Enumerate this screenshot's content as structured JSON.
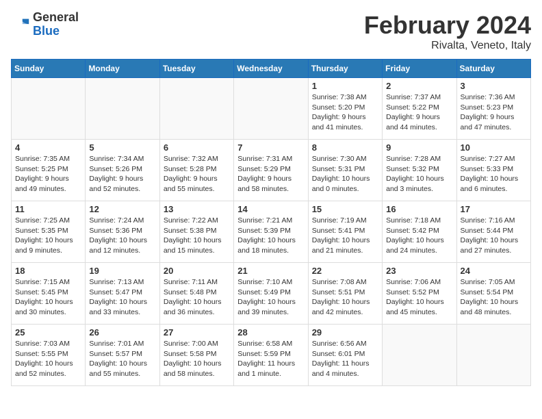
{
  "header": {
    "logo_general": "General",
    "logo_blue": "Blue",
    "month_title": "February 2024",
    "location": "Rivalta, Veneto, Italy"
  },
  "days_of_week": [
    "Sunday",
    "Monday",
    "Tuesday",
    "Wednesday",
    "Thursday",
    "Friday",
    "Saturday"
  ],
  "weeks": [
    [
      {
        "day": "",
        "info": ""
      },
      {
        "day": "",
        "info": ""
      },
      {
        "day": "",
        "info": ""
      },
      {
        "day": "",
        "info": ""
      },
      {
        "day": "1",
        "sunrise": "Sunrise: 7:38 AM",
        "sunset": "Sunset: 5:20 PM",
        "daylight": "Daylight: 9 hours and 41 minutes."
      },
      {
        "day": "2",
        "sunrise": "Sunrise: 7:37 AM",
        "sunset": "Sunset: 5:22 PM",
        "daylight": "Daylight: 9 hours and 44 minutes."
      },
      {
        "day": "3",
        "sunrise": "Sunrise: 7:36 AM",
        "sunset": "Sunset: 5:23 PM",
        "daylight": "Daylight: 9 hours and 47 minutes."
      }
    ],
    [
      {
        "day": "4",
        "sunrise": "Sunrise: 7:35 AM",
        "sunset": "Sunset: 5:25 PM",
        "daylight": "Daylight: 9 hours and 49 minutes."
      },
      {
        "day": "5",
        "sunrise": "Sunrise: 7:34 AM",
        "sunset": "Sunset: 5:26 PM",
        "daylight": "Daylight: 9 hours and 52 minutes."
      },
      {
        "day": "6",
        "sunrise": "Sunrise: 7:32 AM",
        "sunset": "Sunset: 5:28 PM",
        "daylight": "Daylight: 9 hours and 55 minutes."
      },
      {
        "day": "7",
        "sunrise": "Sunrise: 7:31 AM",
        "sunset": "Sunset: 5:29 PM",
        "daylight": "Daylight: 9 hours and 58 minutes."
      },
      {
        "day": "8",
        "sunrise": "Sunrise: 7:30 AM",
        "sunset": "Sunset: 5:31 PM",
        "daylight": "Daylight: 10 hours and 0 minutes."
      },
      {
        "day": "9",
        "sunrise": "Sunrise: 7:28 AM",
        "sunset": "Sunset: 5:32 PM",
        "daylight": "Daylight: 10 hours and 3 minutes."
      },
      {
        "day": "10",
        "sunrise": "Sunrise: 7:27 AM",
        "sunset": "Sunset: 5:33 PM",
        "daylight": "Daylight: 10 hours and 6 minutes."
      }
    ],
    [
      {
        "day": "11",
        "sunrise": "Sunrise: 7:25 AM",
        "sunset": "Sunset: 5:35 PM",
        "daylight": "Daylight: 10 hours and 9 minutes."
      },
      {
        "day": "12",
        "sunrise": "Sunrise: 7:24 AM",
        "sunset": "Sunset: 5:36 PM",
        "daylight": "Daylight: 10 hours and 12 minutes."
      },
      {
        "day": "13",
        "sunrise": "Sunrise: 7:22 AM",
        "sunset": "Sunset: 5:38 PM",
        "daylight": "Daylight: 10 hours and 15 minutes."
      },
      {
        "day": "14",
        "sunrise": "Sunrise: 7:21 AM",
        "sunset": "Sunset: 5:39 PM",
        "daylight": "Daylight: 10 hours and 18 minutes."
      },
      {
        "day": "15",
        "sunrise": "Sunrise: 7:19 AM",
        "sunset": "Sunset: 5:41 PM",
        "daylight": "Daylight: 10 hours and 21 minutes."
      },
      {
        "day": "16",
        "sunrise": "Sunrise: 7:18 AM",
        "sunset": "Sunset: 5:42 PM",
        "daylight": "Daylight: 10 hours and 24 minutes."
      },
      {
        "day": "17",
        "sunrise": "Sunrise: 7:16 AM",
        "sunset": "Sunset: 5:44 PM",
        "daylight": "Daylight: 10 hours and 27 minutes."
      }
    ],
    [
      {
        "day": "18",
        "sunrise": "Sunrise: 7:15 AM",
        "sunset": "Sunset: 5:45 PM",
        "daylight": "Daylight: 10 hours and 30 minutes."
      },
      {
        "day": "19",
        "sunrise": "Sunrise: 7:13 AM",
        "sunset": "Sunset: 5:47 PM",
        "daylight": "Daylight: 10 hours and 33 minutes."
      },
      {
        "day": "20",
        "sunrise": "Sunrise: 7:11 AM",
        "sunset": "Sunset: 5:48 PM",
        "daylight": "Daylight: 10 hours and 36 minutes."
      },
      {
        "day": "21",
        "sunrise": "Sunrise: 7:10 AM",
        "sunset": "Sunset: 5:49 PM",
        "daylight": "Daylight: 10 hours and 39 minutes."
      },
      {
        "day": "22",
        "sunrise": "Sunrise: 7:08 AM",
        "sunset": "Sunset: 5:51 PM",
        "daylight": "Daylight: 10 hours and 42 minutes."
      },
      {
        "day": "23",
        "sunrise": "Sunrise: 7:06 AM",
        "sunset": "Sunset: 5:52 PM",
        "daylight": "Daylight: 10 hours and 45 minutes."
      },
      {
        "day": "24",
        "sunrise": "Sunrise: 7:05 AM",
        "sunset": "Sunset: 5:54 PM",
        "daylight": "Daylight: 10 hours and 48 minutes."
      }
    ],
    [
      {
        "day": "25",
        "sunrise": "Sunrise: 7:03 AM",
        "sunset": "Sunset: 5:55 PM",
        "daylight": "Daylight: 10 hours and 52 minutes."
      },
      {
        "day": "26",
        "sunrise": "Sunrise: 7:01 AM",
        "sunset": "Sunset: 5:57 PM",
        "daylight": "Daylight: 10 hours and 55 minutes."
      },
      {
        "day": "27",
        "sunrise": "Sunrise: 7:00 AM",
        "sunset": "Sunset: 5:58 PM",
        "daylight": "Daylight: 10 hours and 58 minutes."
      },
      {
        "day": "28",
        "sunrise": "Sunrise: 6:58 AM",
        "sunset": "Sunset: 5:59 PM",
        "daylight": "Daylight: 11 hours and 1 minute."
      },
      {
        "day": "29",
        "sunrise": "Sunrise: 6:56 AM",
        "sunset": "Sunset: 6:01 PM",
        "daylight": "Daylight: 11 hours and 4 minutes."
      },
      {
        "day": "",
        "info": ""
      },
      {
        "day": "",
        "info": ""
      }
    ]
  ]
}
